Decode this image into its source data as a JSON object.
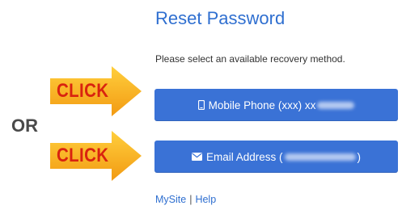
{
  "page": {
    "title": "Reset Password",
    "instructions": "Please select an available recovery method."
  },
  "recovery_options": {
    "phone": {
      "label": "Mobile Phone (xxx) xx",
      "icon": "mobile-phone-icon"
    },
    "email": {
      "label": "Email Address (",
      "suffix": ")",
      "icon": "envelope-icon"
    }
  },
  "footer": {
    "mysite_label": "MySite",
    "separator": "|",
    "help_label": "Help"
  },
  "annotations": {
    "click_label_1": "CLICK",
    "click_label_2": "CLICK",
    "or_label": "OR"
  },
  "colors": {
    "title": "#2f6fd0",
    "button": "#3a72d6",
    "arrow_fill": "#f5a623",
    "arrow_text": "#d9230f"
  }
}
